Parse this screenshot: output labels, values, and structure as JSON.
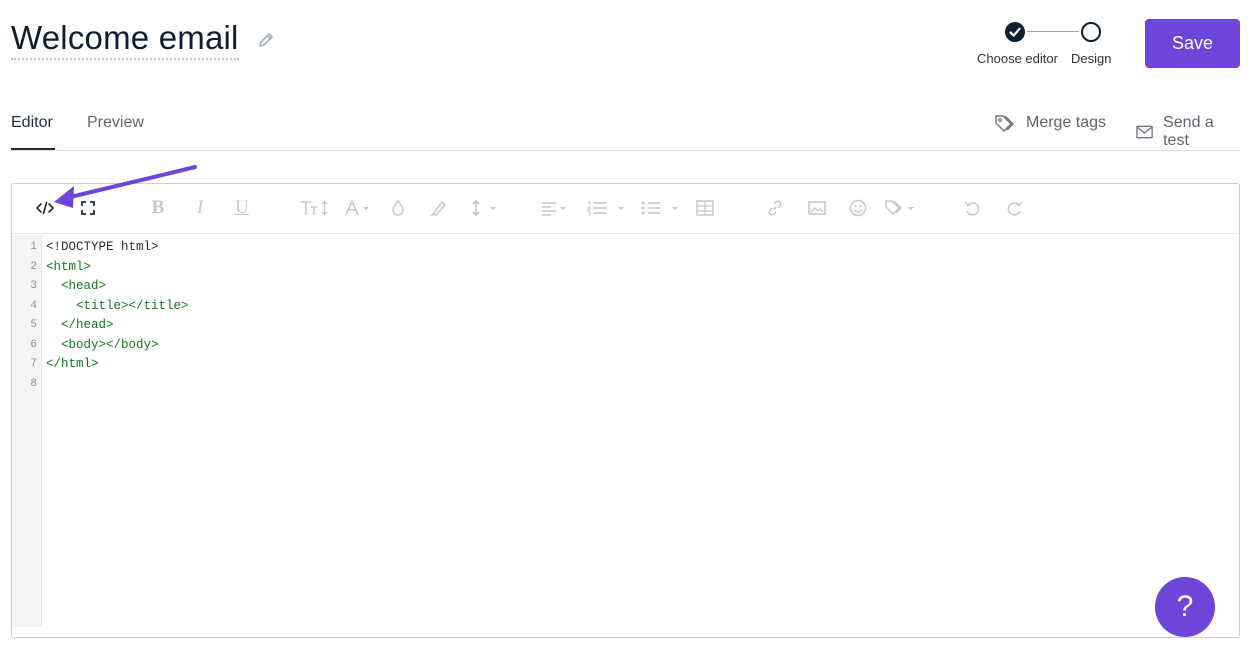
{
  "header": {
    "title": "Welcome email",
    "steps": [
      {
        "label": "Choose editor",
        "done": true
      },
      {
        "label": "Design",
        "done": false
      }
    ],
    "save_label": "Save"
  },
  "tabs": {
    "items": [
      {
        "label": "Editor",
        "active": true
      },
      {
        "label": "Preview",
        "active": false
      }
    ],
    "merge_tags_label": "Merge tags",
    "send_test_label": "Send a test"
  },
  "toolbar": {
    "icons": [
      "code-view-icon",
      "fullscreen-icon",
      "bold-icon",
      "italic-icon",
      "underline-icon",
      "font-size-icon",
      "font-color-icon",
      "background-color-icon",
      "clear-format-icon",
      "line-height-icon",
      "align-icon",
      "ordered-list-icon",
      "unordered-list-icon",
      "table-icon",
      "link-icon",
      "image-icon",
      "emoji-icon",
      "merge-tag-icon",
      "undo-icon",
      "redo-icon"
    ],
    "bold_glyph": "B",
    "italic_glyph": "I",
    "underline_glyph": "U"
  },
  "code": {
    "line_numbers": [
      "1",
      "2",
      "3",
      "4",
      "5",
      "6",
      "7",
      "8"
    ],
    "lines": [
      "<!DOCTYPE html>",
      "<html>",
      "  <head>",
      "    <title></title>",
      "  </head>",
      "  <body></body>",
      "</html>",
      ""
    ]
  },
  "help": {
    "label": "?"
  },
  "colors": {
    "accent": "#6d45d9",
    "ink": "#0f1f33",
    "code_tag": "#117a1a"
  }
}
